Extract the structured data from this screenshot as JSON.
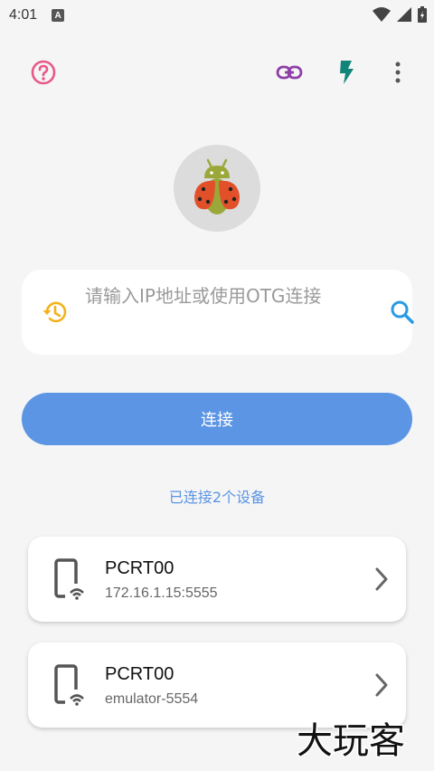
{
  "status_bar": {
    "time": "4:01",
    "notification_badge": "A",
    "icons": [
      "wifi-icon",
      "signal-icon",
      "battery-icon"
    ]
  },
  "toolbar": {
    "icons": [
      "help-icon",
      "link-icon",
      "flash-icon",
      "more-vert-icon"
    ]
  },
  "colors": {
    "accent": "#5b95e4",
    "help": "#e8578a",
    "link": "#8e3fa8",
    "flash": "#12857a",
    "history": "#f2b21a",
    "search": "#2a9be3"
  },
  "search": {
    "placeholder": "请输入IP地址或使用OTG连接",
    "value": ""
  },
  "connect_button": {
    "label": "连接"
  },
  "connected_count": "已连接2个设备",
  "devices": [
    {
      "name": "PCRT00",
      "address": "172.16.1.15:5555"
    },
    {
      "name": "PCRT00",
      "address": "emulator-5554"
    }
  ],
  "watermark": "大玩客"
}
